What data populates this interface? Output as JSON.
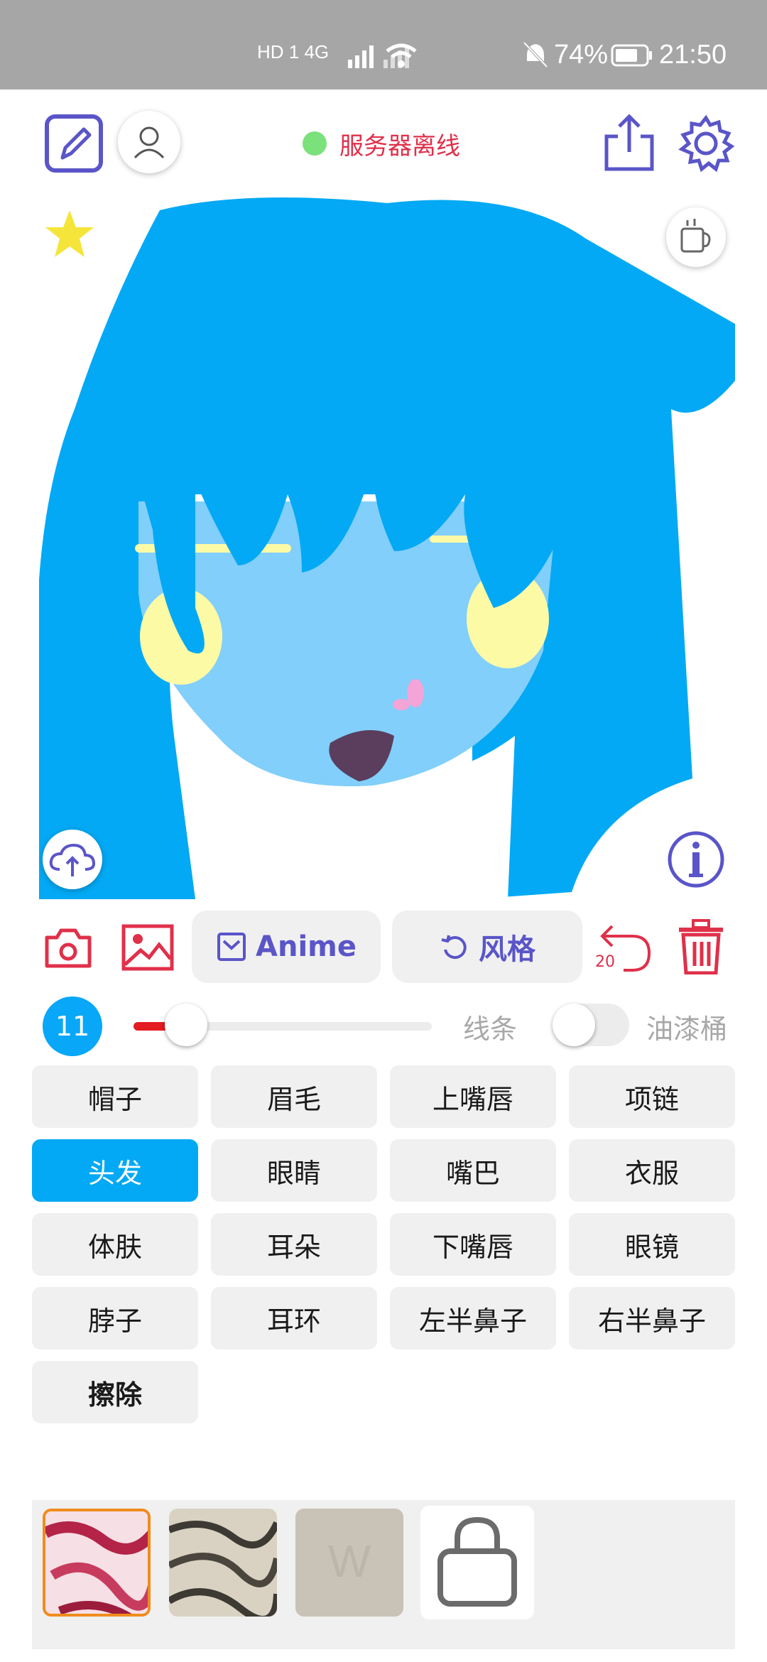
{
  "status_bar": {
    "network_text": "HD 1  4G",
    "battery_percent": "74%",
    "time": "21:50"
  },
  "header": {
    "server_status": "服务器离线",
    "server_status_color": "#7be17b"
  },
  "toolbar": {
    "anime_label": "Anime",
    "style_label": "风格",
    "undo_count": "20"
  },
  "brush": {
    "size": "11",
    "size_fraction": 0.12,
    "line_label": "线条",
    "bucket_label": "油漆桶",
    "bucket_enabled": false
  },
  "categories": [
    {
      "label": "帽子"
    },
    {
      "label": "眉毛"
    },
    {
      "label": "上嘴唇"
    },
    {
      "label": "项链"
    },
    {
      "label": "头发"
    },
    {
      "label": "眼睛"
    },
    {
      "label": "嘴巴"
    },
    {
      "label": "衣服"
    },
    {
      "label": "体肤"
    },
    {
      "label": "耳朵"
    },
    {
      "label": "下嘴唇"
    },
    {
      "label": "眼镜"
    },
    {
      "label": "脖子"
    },
    {
      "label": "耳环"
    },
    {
      "label": "左半鼻子"
    },
    {
      "label": "右半鼻子"
    },
    {
      "label": "擦除"
    }
  ],
  "selected_category": "头发",
  "colors": {
    "accent": "#5a55c8",
    "selected": "#03a9f4",
    "danger": "#e0304a",
    "hair": "#03a9f4",
    "skin": "#81cffa",
    "eyes": "#fdfaa6"
  }
}
